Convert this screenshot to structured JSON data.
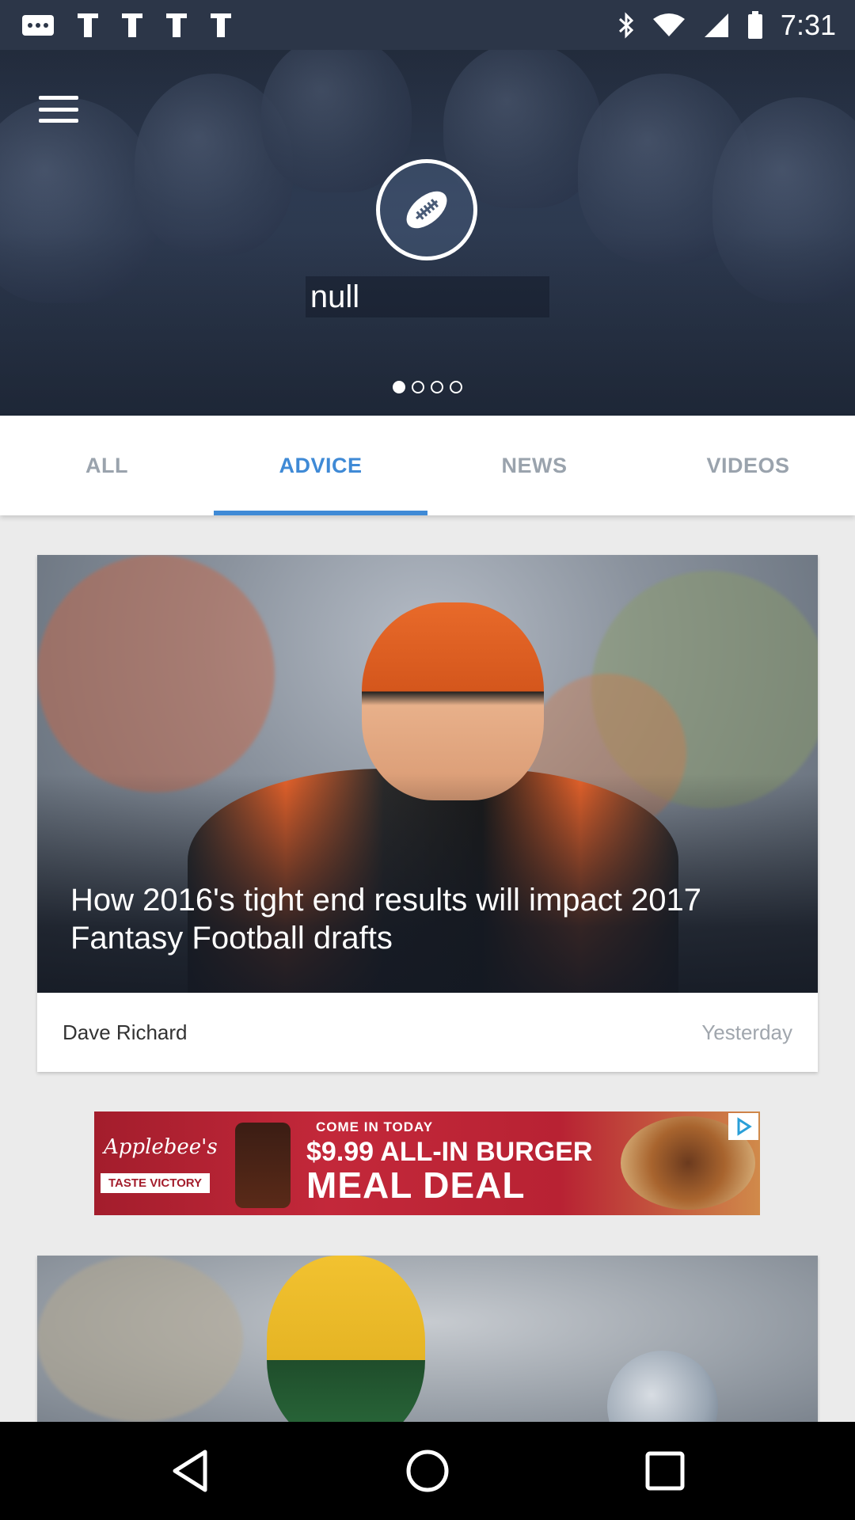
{
  "status_bar": {
    "time": "7:31",
    "icons": [
      "notification-icon",
      "notification-icon",
      "notification-icon",
      "notification-icon",
      "notification-icon",
      "bluetooth-icon",
      "wifi-icon",
      "signal-icon",
      "battery-icon"
    ]
  },
  "hero": {
    "title": "null",
    "page_count": 4,
    "active_page": 1
  },
  "tabs": [
    {
      "label": "ALL",
      "active": false
    },
    {
      "label": "ADVICE",
      "active": true
    },
    {
      "label": "NEWS",
      "active": false
    },
    {
      "label": "VIDEOS",
      "active": false
    }
  ],
  "articles": [
    {
      "title": "How 2016's tight end results will impact 2017 Fantasy Football drafts",
      "author": "Dave Richard",
      "time": "Yesterday"
    }
  ],
  "ad": {
    "brand": "Applebee's",
    "tagline": "TASTE VICTORY",
    "line1": "COME IN TODAY",
    "line2": "$9.99 ALL-IN BURGER",
    "line3": "MEAL DEAL"
  },
  "colors": {
    "accent": "#3f8ad6",
    "status_bar": "#2c3648"
  },
  "navbar": [
    "back-icon",
    "home-icon",
    "recents-icon"
  ]
}
